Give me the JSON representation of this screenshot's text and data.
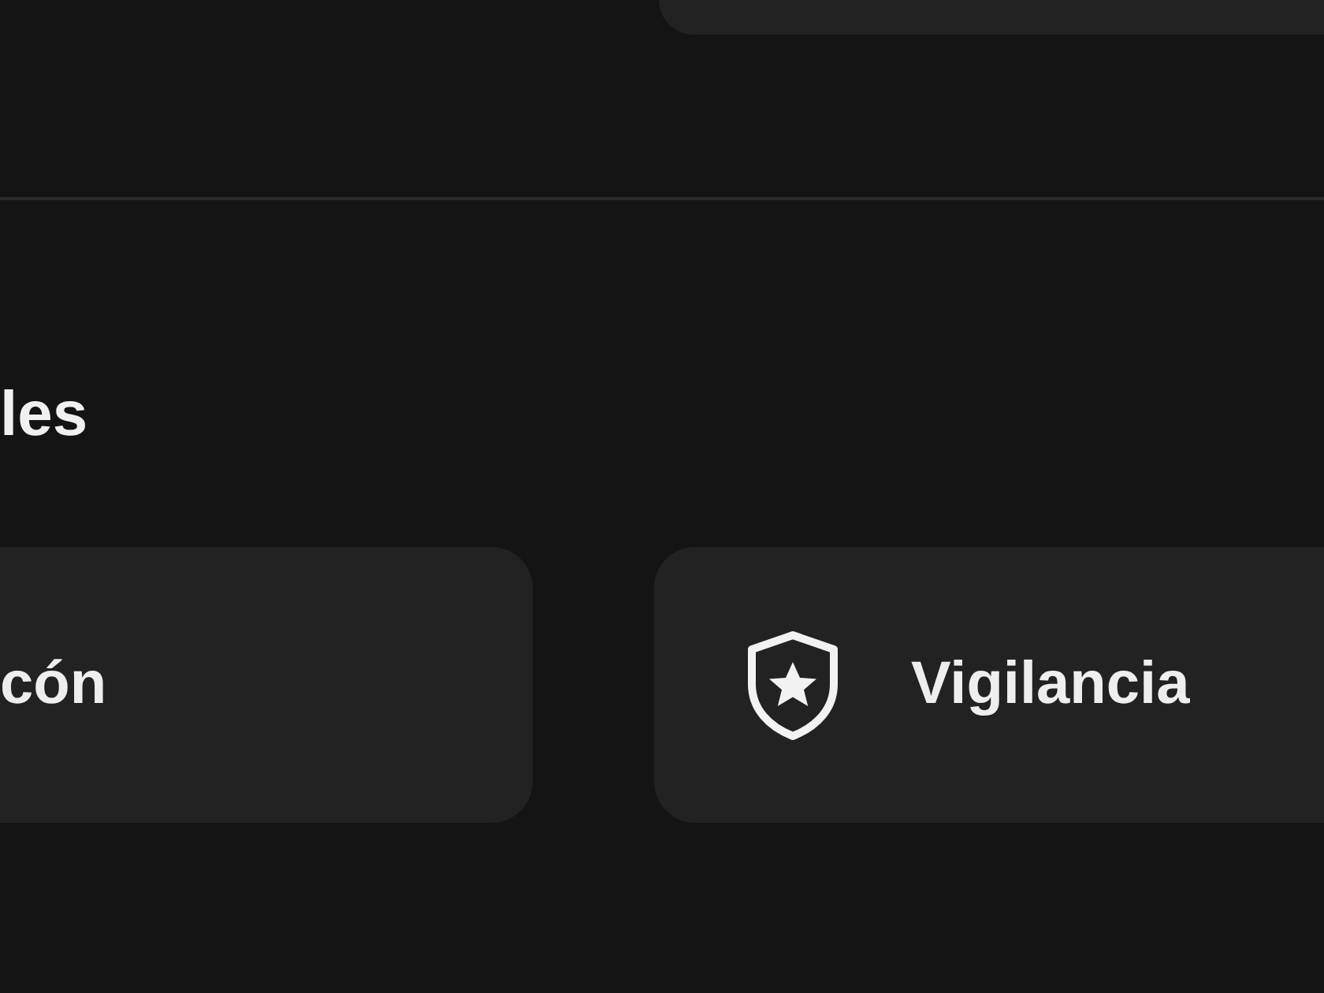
{
  "section": {
    "heading": "les",
    "cards": [
      {
        "label": "cón",
        "kind": "plain"
      },
      {
        "label": "Vigilancia",
        "kind": "shield"
      }
    ]
  }
}
